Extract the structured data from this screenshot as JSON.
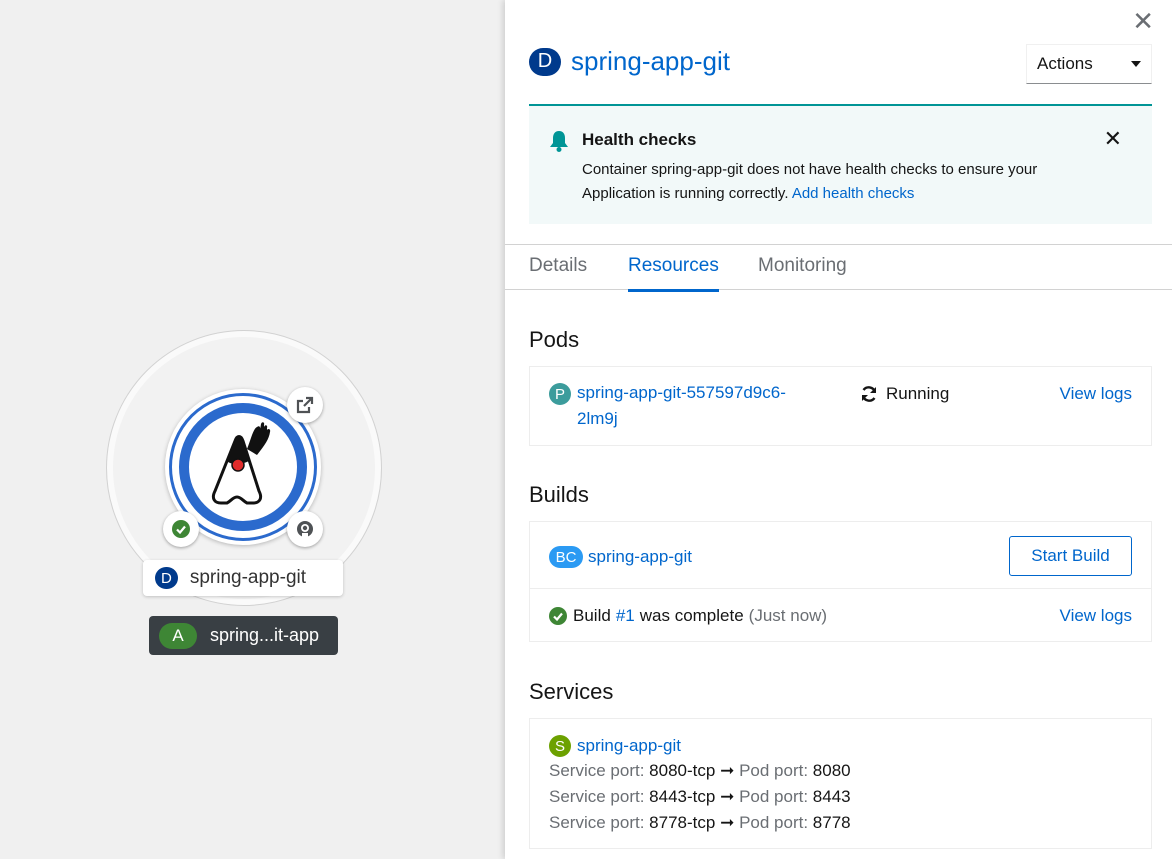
{
  "topology": {
    "node_label": "spring-app-git",
    "node_badge": "D",
    "app_label": "spring...it-app",
    "app_badge": "A"
  },
  "panel": {
    "close_icon": "close-icon",
    "title_badge": "D",
    "title": "spring-app-git",
    "actions_label": "Actions",
    "alert": {
      "title": "Health checks",
      "body": "Container spring-app-git does not have health checks to ensure your Application is running correctly.",
      "link": "Add health checks"
    },
    "tabs": [
      "Details",
      "Resources",
      "Monitoring"
    ],
    "active_tab": "Resources",
    "pods": {
      "heading": "Pods",
      "badge": "P",
      "name_line1": "spring-app-git-557597d9c6-",
      "name_line2": "2lm9j",
      "status": "Running",
      "logs_link": "View logs"
    },
    "builds": {
      "heading": "Builds",
      "badge": "BC",
      "name": "spring-app-git",
      "start_button": "Start Build",
      "build_prefix": "Build",
      "build_number": "#1",
      "build_suffix": "was complete",
      "build_time": "(Just now)",
      "logs_link": "View logs"
    },
    "services": {
      "heading": "Services",
      "badge": "S",
      "name": "spring-app-git",
      "service_port_label": "Service port:",
      "pod_port_label": "Pod port:",
      "ports": [
        {
          "service": "8080-tcp",
          "pod": "8080"
        },
        {
          "service": "8443-tcp",
          "pod": "8443"
        },
        {
          "service": "8778-tcp",
          "pod": "8778"
        }
      ]
    }
  },
  "colors": {
    "link": "#0066cc",
    "deployment_badge": "#003a8c",
    "pod_badge": "#3c9c9c",
    "buildconfig_badge": "#2b9af3",
    "service_badge": "#6ca100",
    "success": "#3e8635"
  }
}
